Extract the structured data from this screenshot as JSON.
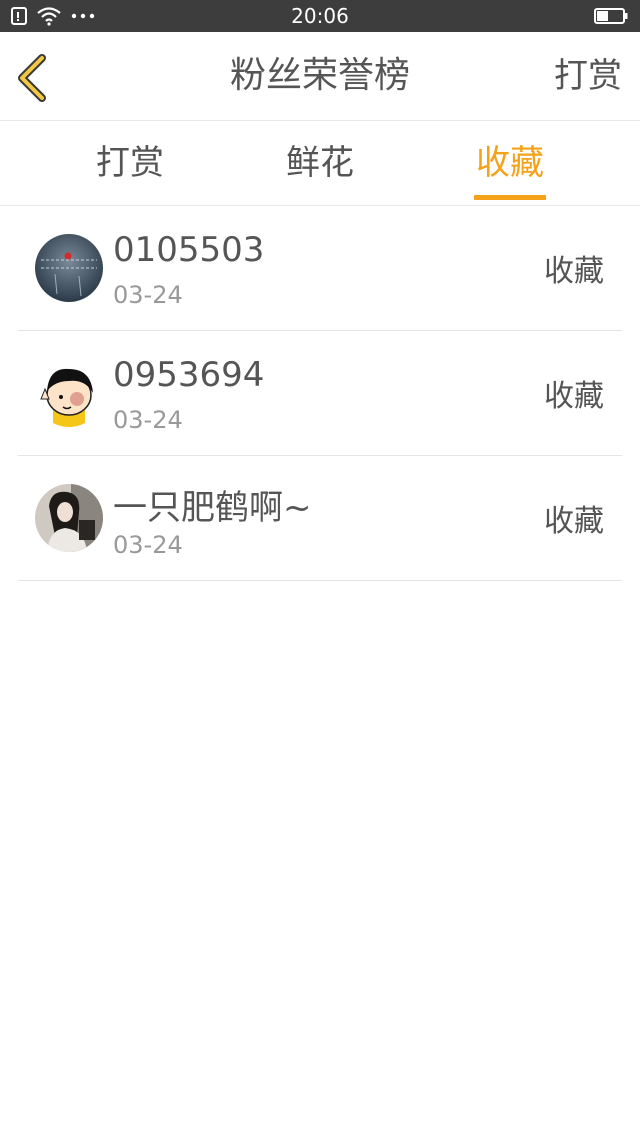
{
  "status_bar": {
    "time": "20:06",
    "icons": [
      "sim-icon",
      "wifi-icon",
      "more-dots-icon",
      "battery-icon"
    ]
  },
  "header": {
    "title": "粉丝荣誉榜",
    "action_label": "打赏",
    "back_icon": "chevron-left-icon"
  },
  "tabs": [
    {
      "label": "打赏",
      "active": false
    },
    {
      "label": "鲜花",
      "active": false
    },
    {
      "label": "收藏",
      "active": true
    }
  ],
  "colors": {
    "accent": "#f5a21b",
    "text": "#555555",
    "subtext": "#999999",
    "status_bar": "#3d3d3d"
  },
  "list": [
    {
      "name": "0105503",
      "date": "03-24",
      "type": "收藏",
      "avatar": "avatar-rain-image"
    },
    {
      "name": "0953694",
      "date": "03-24",
      "type": "收藏",
      "avatar": "avatar-cartoon-girl"
    },
    {
      "name": "一只肥鹤啊~",
      "date": "03-24",
      "type": "收藏",
      "avatar": "avatar-woman-photo"
    }
  ]
}
